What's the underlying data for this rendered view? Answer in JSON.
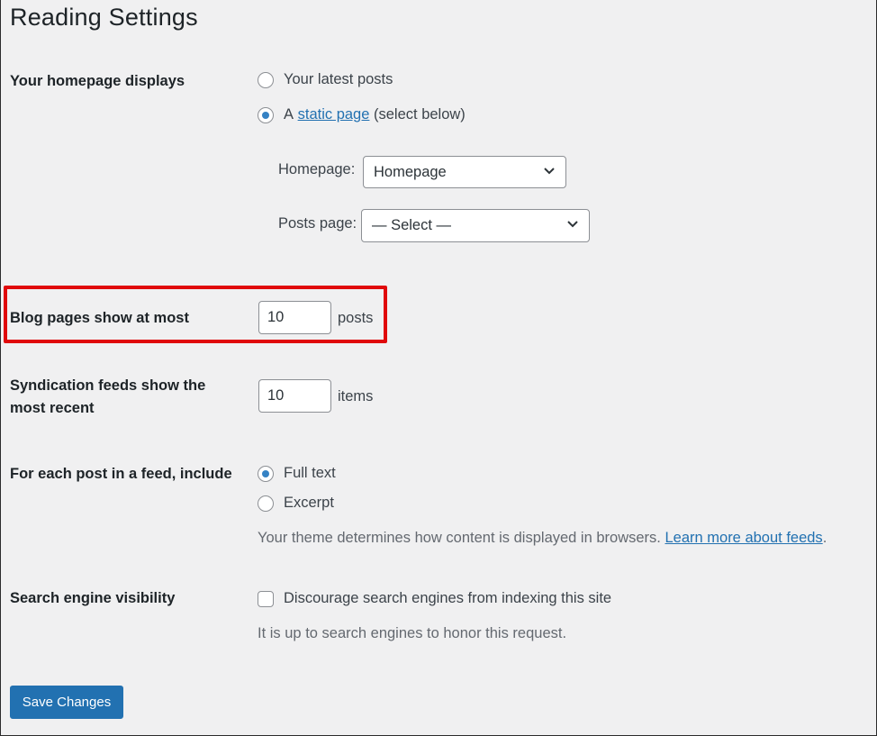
{
  "page": {
    "title": "Reading Settings"
  },
  "homepage_displays": {
    "label": "Your homepage displays",
    "options": [
      {
        "label": "Your latest posts",
        "checked": false
      },
      {
        "prefix": "A",
        "link": "static page",
        "suffix": "(select below)",
        "checked": true
      }
    ],
    "homepage_label": "Homepage:",
    "homepage_value": "Homepage",
    "posts_page_label": "Posts page:",
    "posts_page_value": "— Select —"
  },
  "blog_pages": {
    "label": "Blog pages show at most",
    "value": "10",
    "unit": "posts"
  },
  "syndication": {
    "label_line1": "Syndication feeds show the",
    "label_line2": "most recent",
    "value": "10",
    "unit": "items"
  },
  "feed_include": {
    "label": "For each post in a feed, include",
    "options": [
      {
        "label": "Full text",
        "checked": true
      },
      {
        "label": "Excerpt",
        "checked": false
      }
    ],
    "description": "Your theme determines how content is displayed in browsers.",
    "link": "Learn more about feeds",
    "link_suffix": "."
  },
  "search_visibility": {
    "label": "Search engine visibility",
    "checkbox_label": "Discourage search engines from indexing this site",
    "checked": false,
    "description": "It is up to search engines to honor this request."
  },
  "actions": {
    "save_label": "Save Changes"
  },
  "colors": {
    "accent": "#2271b1",
    "highlight": "#e0080b",
    "background": "#f0f0f1"
  }
}
